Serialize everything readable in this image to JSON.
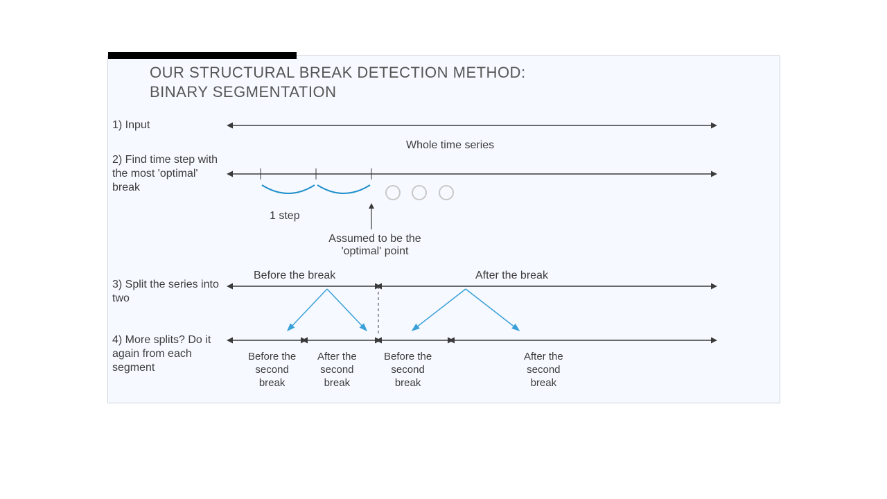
{
  "title_line1": "OUR STRUCTURAL BREAK DETECTION METHOD:",
  "title_line2": "BINARY SEGMENTATION",
  "steps": {
    "s1": "1) Input",
    "s2": "2) Find time step with the most 'optimal' break",
    "s3": "3) Split the series into two",
    "s4": "4) More splits? Do it again from each segment"
  },
  "annotations": {
    "whole_series": "Whole time series",
    "one_step": "1 step",
    "assumed_line1": "Assumed to be the",
    "assumed_line2": "'optimal' point",
    "before_break": "Before the break",
    "after_break": "After the break",
    "before_second_1": "Before the",
    "before_second_2": "second",
    "before_second_3": "break",
    "after_second_1": "After the",
    "after_second_2": "second",
    "after_second_3": "break"
  }
}
